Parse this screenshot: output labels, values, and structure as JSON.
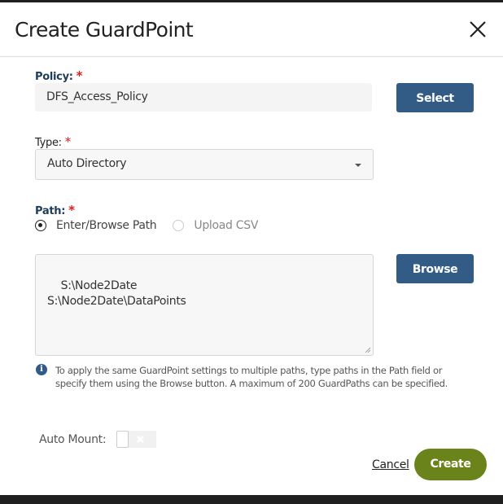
{
  "dialog": {
    "title": "Create GuardPoint",
    "close_icon": "close-icon"
  },
  "policy": {
    "label": "Policy:",
    "required": "*",
    "value": "DFS_Access_Policy",
    "select_button": "Select"
  },
  "type": {
    "label": "Type:",
    "required": "*",
    "selected": "Auto Directory"
  },
  "path": {
    "label": "Path:",
    "required": "*",
    "options": [
      {
        "label": "Enter/Browse Path",
        "selected": true
      },
      {
        "label": "Upload CSV",
        "selected": false
      }
    ],
    "value": "S:\\Node2Date\nS:\\Node2Date\\DataPoints",
    "browse_button": "Browse",
    "help_icon": "i",
    "help_text": "To apply the same GuardPoint settings to multiple paths, type paths in the Path field or specify them using the Browse button. A maximum of 200 GuardPaths can be specified."
  },
  "auto_mount": {
    "label": "Auto Mount:",
    "enabled": false
  },
  "footer": {
    "cancel": "Cancel",
    "create": "Create"
  },
  "colors": {
    "primary_blue": "#325c86",
    "create_green": "#6a841b",
    "required_red": "#e01b1b"
  }
}
